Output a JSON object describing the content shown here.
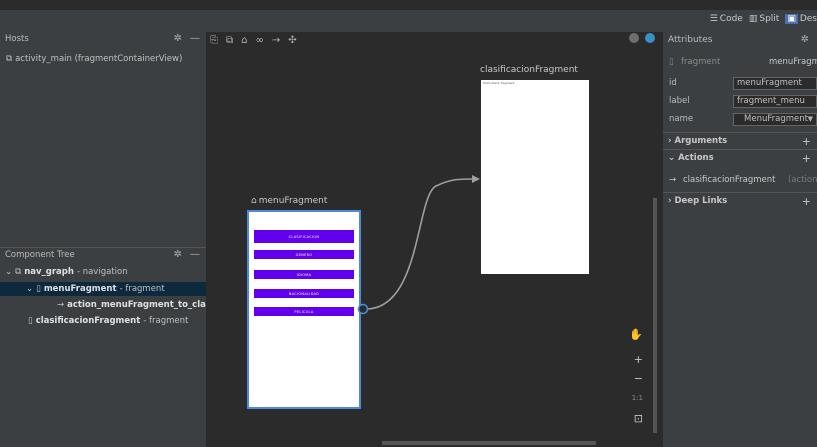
{
  "view_modes": {
    "code": "Code",
    "split": "Split",
    "design": "Des"
  },
  "hosts": {
    "title": "Hosts",
    "item": "activity_main (fragmentContainerView)"
  },
  "component_tree": {
    "title": "Component Tree",
    "graph_name": "nav_graph",
    "graph_type": "- navigation",
    "menu_name": "menuFragment",
    "menu_type": "- fragment",
    "action_name": "action_menuFragment_to_clasifi",
    "clas_name": "clasificacionFragment",
    "clas_type": "- fragment"
  },
  "canvas": {
    "clas_title": "clasificacionFragment",
    "clas_preview_text": "Hello blank fragment",
    "menu_title": "menuFragment",
    "buttons": [
      "CLASIFICACION",
      "GENERO",
      "IDIOMA",
      "NACIONALIDAD",
      "PELICULA"
    ],
    "zoom_reset": "1:1"
  },
  "attributes": {
    "title": "Attributes",
    "type_label": "fragment",
    "type_value": "menuFragm",
    "rows": [
      {
        "key": "id",
        "value": "menuFragment"
      },
      {
        "key": "label",
        "value": "fragment_menu"
      },
      {
        "key": "name",
        "value": "MenuFragment"
      }
    ],
    "sections": {
      "arguments": "Arguments",
      "actions": "Actions",
      "deep_links": "Deep Links"
    },
    "action_target": "clasificacionFragment",
    "action_suffix": "(action_me"
  },
  "colors": {
    "accent": "#6200ee",
    "selection": "#0d293e",
    "link": "#4b6eaf"
  }
}
